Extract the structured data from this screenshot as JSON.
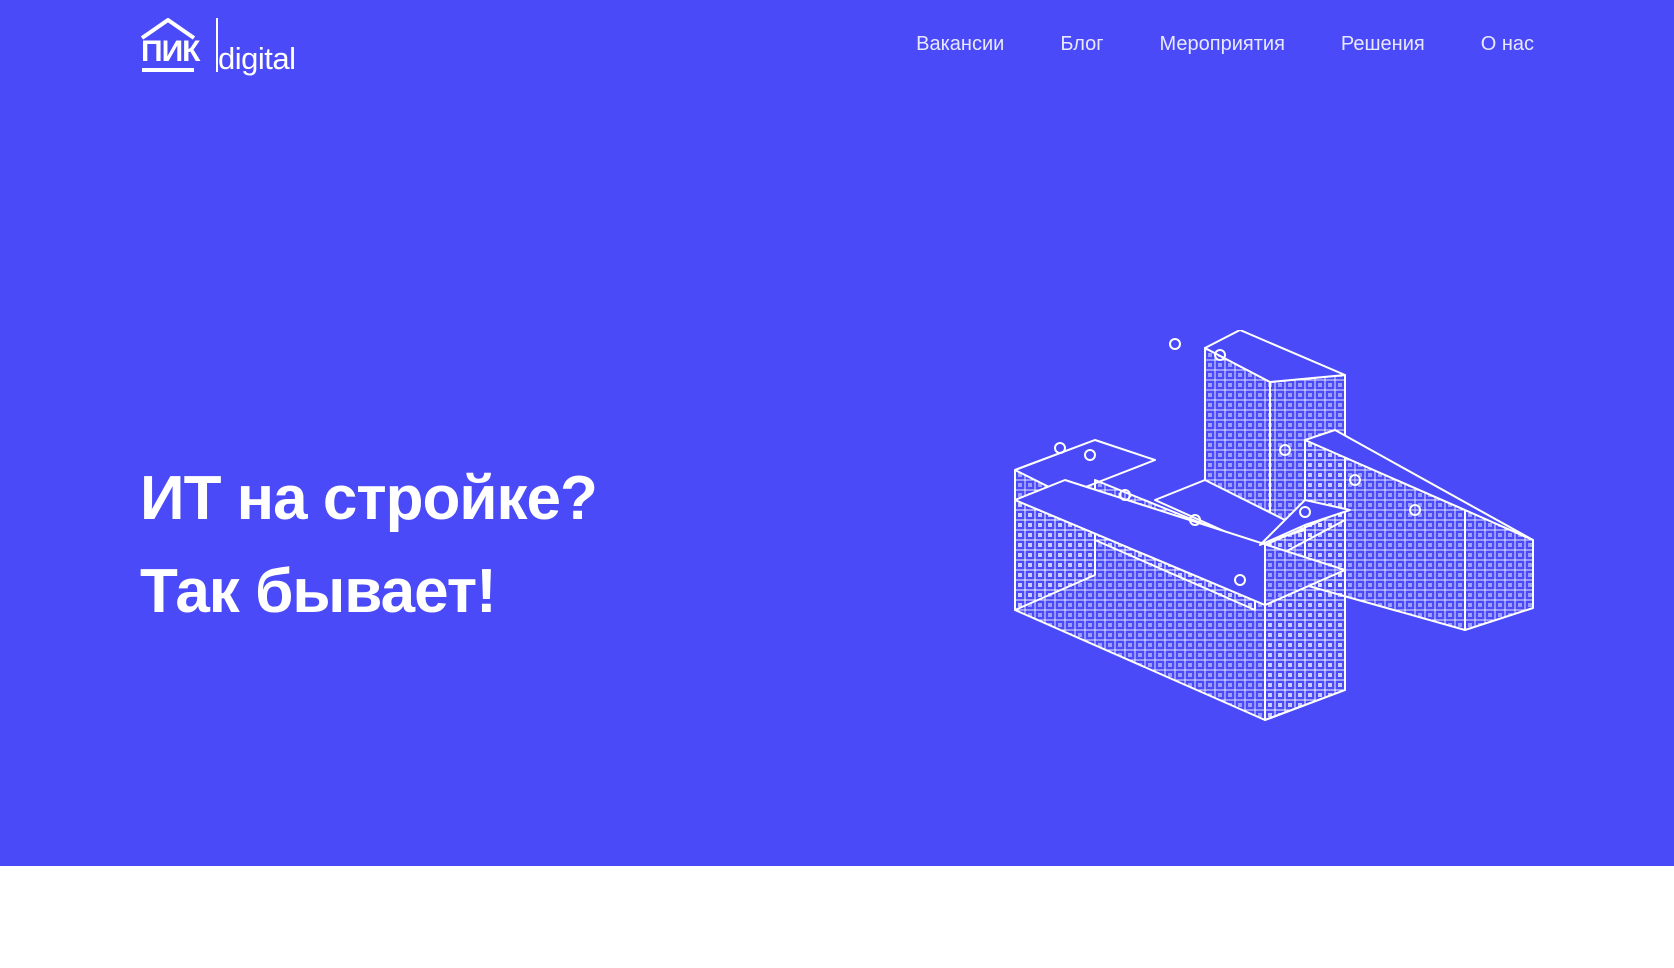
{
  "brand": {
    "logo_mark": "ПИК",
    "logo_text": "digital",
    "accent_color": "#4a4af8"
  },
  "nav": {
    "items": [
      {
        "label": "Вакансии"
      },
      {
        "label": "Блог"
      },
      {
        "label": "Мероприятия"
      },
      {
        "label": "Решения"
      },
      {
        "label": "О нас"
      }
    ]
  },
  "hero": {
    "headline_line1": "ИТ на стройке?",
    "headline_line2": "Так бывает!",
    "illustration_icon": "isometric-building-wireframe"
  }
}
